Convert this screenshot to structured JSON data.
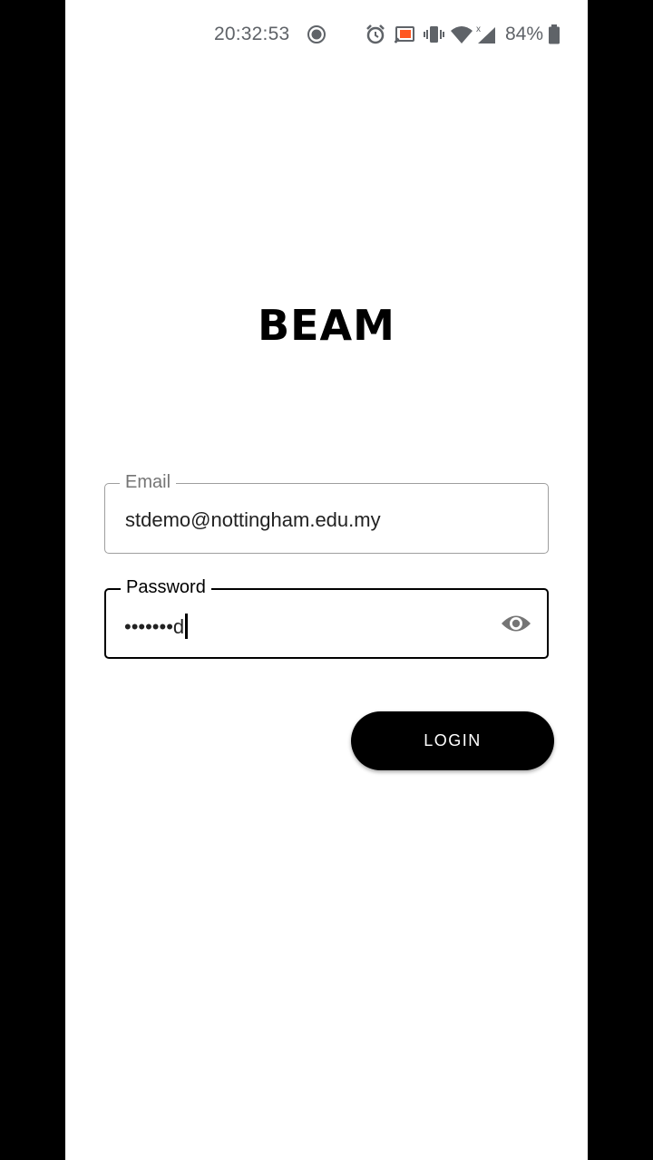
{
  "status_bar": {
    "time": "20:32:53",
    "battery": "84%",
    "icons": [
      "record-icon",
      "alarm-icon",
      "cast-icon",
      "vibrate-icon",
      "wifi-icon",
      "signal-icon",
      "battery-icon"
    ]
  },
  "app": {
    "logo": "BEAM"
  },
  "login_form": {
    "email": {
      "label": "Email",
      "value": "stdemo@nottingham.edu.my"
    },
    "password": {
      "label": "Password",
      "masked_value": "•••••••d",
      "toggle_icon": "eye-icon"
    },
    "login_label": "LOGIN"
  },
  "colors": {
    "background": "#ffffff",
    "accent": "#000000",
    "status_text": "#5f6368",
    "cast_accent": "#ff5722"
  }
}
